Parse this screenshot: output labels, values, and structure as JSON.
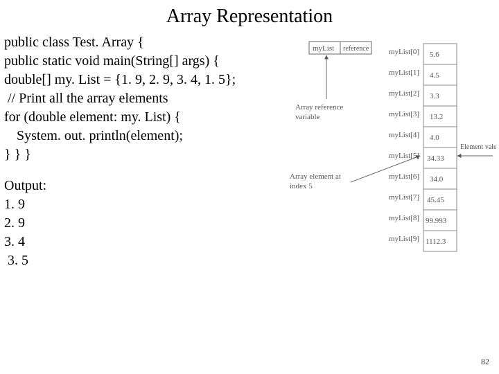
{
  "title": "Array Representation",
  "code": {
    "l1": "public class Test. Array {",
    "l2": "public static void main(String[] args) {",
    "l3": "double[] my. List = {1. 9, 2. 9, 3. 4, 1. 5};",
    "l4": " // Print all the array elements",
    "l5": "for (double element: my. List) {",
    "l6": "System. out. println(element);",
    "l7": "} } }"
  },
  "output": {
    "label": "Output:",
    "o1": "1. 9",
    "o2": "2. 9",
    "o3": "3. 4",
    "o4": " 3. 5"
  },
  "diagram": {
    "refbox_left": "myList",
    "refbox_right": "reference",
    "ref_label_1": "Array reference",
    "ref_label_2": "variable",
    "elem_label_1": "Array element at",
    "elem_label_2": "index 5",
    "elem_value_label": "Element value",
    "rows": [
      {
        "idx": "myList[0]",
        "val": "5.6"
      },
      {
        "idx": "myList[1]",
        "val": "4.5"
      },
      {
        "idx": "myList[2]",
        "val": "3.3"
      },
      {
        "idx": "myList[3]",
        "val": "13.2"
      },
      {
        "idx": "myList[4]",
        "val": "4.0"
      },
      {
        "idx": "myList[5]",
        "val": "34.33"
      },
      {
        "idx": "myList[6]",
        "val": "34.0"
      },
      {
        "idx": "myList[7]",
        "val": "45.45"
      },
      {
        "idx": "myList[8]",
        "val": "99.993"
      },
      {
        "idx": "myList[9]",
        "val": "1112.3"
      }
    ]
  },
  "page_number": "82"
}
